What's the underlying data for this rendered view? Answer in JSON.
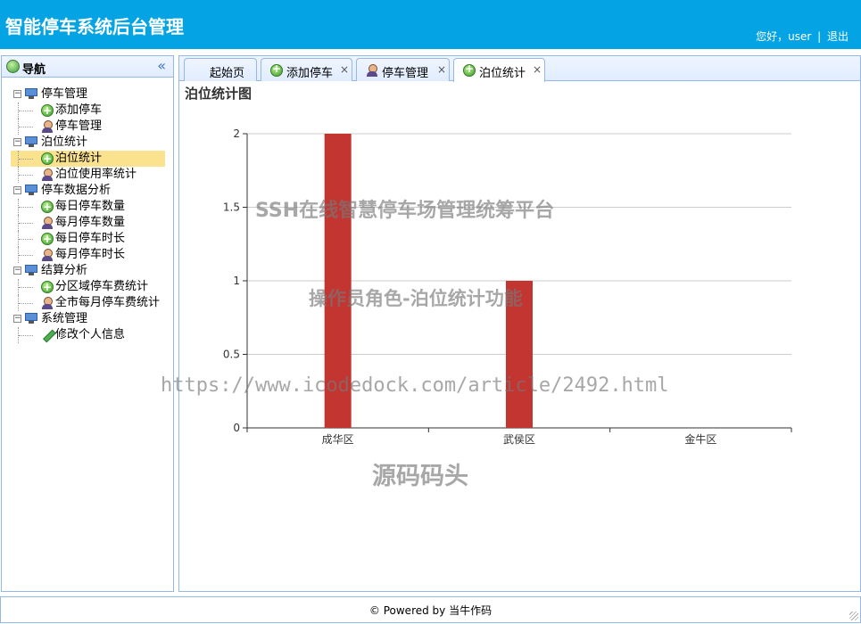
{
  "header": {
    "title": "智能停车系统后台管理",
    "greeting": "您好，user",
    "logout": "退出"
  },
  "nav": {
    "title": "导航",
    "groups": [
      {
        "label": "停车管理",
        "items": [
          {
            "label": "添加停车",
            "icon": "add-icon"
          },
          {
            "label": "停车管理",
            "icon": "user-icon"
          }
        ]
      },
      {
        "label": "泊位统计",
        "items": [
          {
            "label": "泊位统计",
            "icon": "add-icon",
            "selected": true
          },
          {
            "label": "泊位使用率统计",
            "icon": "user-icon"
          }
        ]
      },
      {
        "label": "停车数据分析",
        "items": [
          {
            "label": "每日停车数量",
            "icon": "add-icon"
          },
          {
            "label": "每月停车数量",
            "icon": "user-icon"
          },
          {
            "label": "每日停车时长",
            "icon": "add-icon"
          },
          {
            "label": "每月停车时长",
            "icon": "user-icon"
          }
        ]
      },
      {
        "label": "结算分析",
        "items": [
          {
            "label": "分区域停车费统计",
            "icon": "add-icon"
          },
          {
            "label": "全市每月停车费统计",
            "icon": "user-icon"
          }
        ]
      },
      {
        "label": "系统管理",
        "items": [
          {
            "label": "修改个人信息",
            "icon": "pencil-icon"
          }
        ]
      }
    ]
  },
  "tabs": [
    {
      "label": "起始页",
      "icon": "",
      "closable": false
    },
    {
      "label": "添加停车",
      "icon": "add-icon",
      "closable": true
    },
    {
      "label": "停车管理",
      "icon": "user-icon",
      "closable": true
    },
    {
      "label": "泊位统计",
      "icon": "add-icon",
      "closable": true,
      "active": true
    }
  ],
  "tab_close_glyph": "×",
  "content": {
    "title": "泊位统计图"
  },
  "watermarks": {
    "line1": "SSH在线智慧停车场管理统筹平台",
    "line2": "操作员角色-泊位统计功能",
    "line3": "https://www.icodedock.com/article/2492.html",
    "line4": "源码码头"
  },
  "footer": {
    "text": "© Powered by 当牛作码"
  },
  "colors": {
    "header_bg": "#04a4e4",
    "bar": "#c23531",
    "selected_bg": "#fbe28e"
  },
  "chart_data": {
    "type": "bar",
    "categories": [
      "成华区",
      "武侯区",
      "金牛区"
    ],
    "values": [
      2,
      1,
      0
    ],
    "ylim": [
      0,
      2
    ],
    "yticks": [
      0,
      0.5,
      1,
      1.5,
      2
    ],
    "grid": true,
    "xlabel": "",
    "ylabel": ""
  }
}
